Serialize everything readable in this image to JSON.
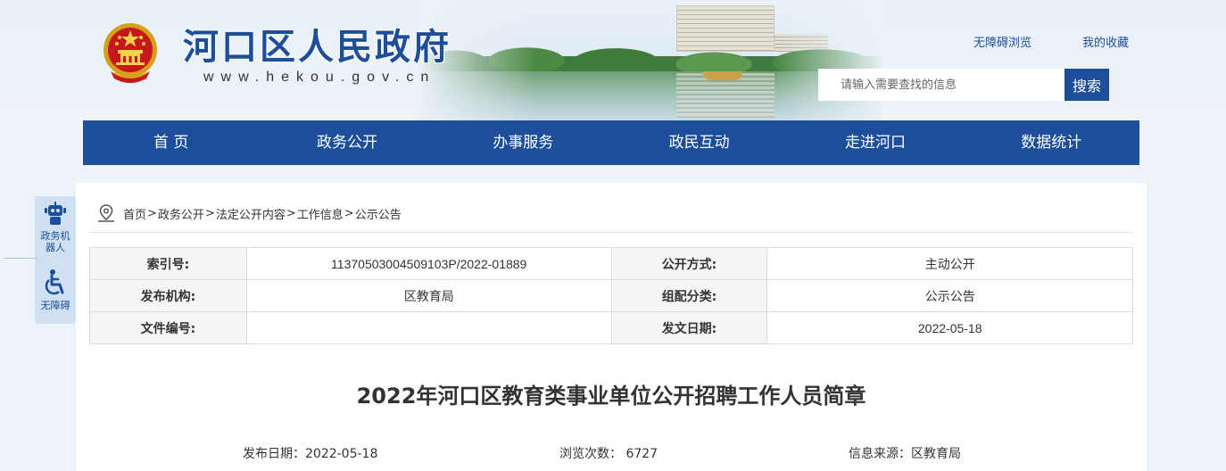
{
  "site": {
    "title": "河口区人民政府",
    "domain": "www.hekou.gov.cn",
    "links": {
      "accessible": "无障碍浏览",
      "favorites": "我的收藏"
    },
    "search": {
      "placeholder": "请输入需要查找的信息",
      "button": "搜索"
    }
  },
  "nav": [
    "首 页",
    "政务公开",
    "办事服务",
    "政民互动",
    "走进河口",
    "数据统计"
  ],
  "side_tools": [
    {
      "label": "政务机器人",
      "icon": "robot-icon"
    },
    {
      "label": "无障碍",
      "icon": "wheelchair-icon"
    }
  ],
  "breadcrumb": [
    "首页",
    "政务公开",
    "法定公开内容",
    "工作信息",
    "公示公告"
  ],
  "breadcrumb_sep": ">",
  "meta": {
    "index_label": "索引号:",
    "index_value": "11370503004509103P/2022-01889",
    "open_mode_label": "公开方式:",
    "open_mode_value": "主动公开",
    "publisher_label": "发布机构:",
    "publisher_value": "区教育局",
    "category_label": "组配分类:",
    "category_value": "公示公告",
    "doc_no_label": "文件编号:",
    "doc_no_value": "",
    "doc_date_label": "发文日期:",
    "doc_date_value": "2022-05-18"
  },
  "article": {
    "title": "2022年河口区教育类事业单位公开招聘工作人员简章",
    "publish_date": "发布日期：2022-05-18",
    "views": "浏览次数： 6727",
    "source": "信息来源：区教育局"
  },
  "colors": {
    "brand": "#1c4e9b",
    "page_bg": "#eef3f9"
  }
}
